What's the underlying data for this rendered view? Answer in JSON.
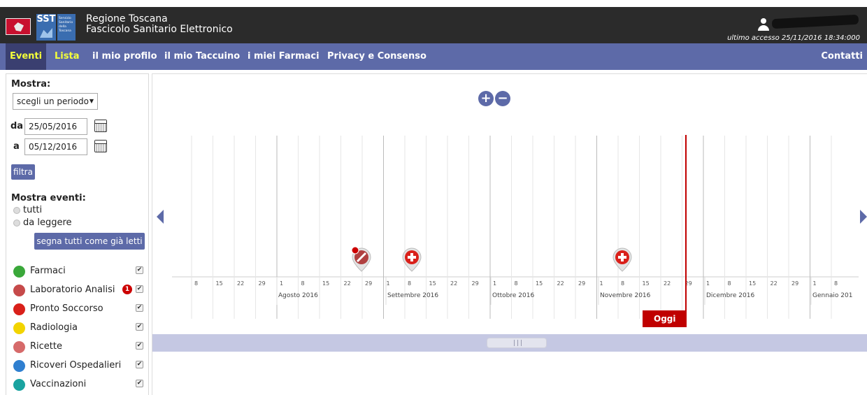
{
  "header": {
    "title_line1": "Regione Toscana",
    "title_line2": "Fascicolo Sanitario Elettronico",
    "sst_logo": "SST",
    "sst_logo_small": "Servizio Sanitario della Toscana",
    "last_access": "ultimo accesso 25/11/2016 18:34:000"
  },
  "nav": {
    "items": [
      "Eventi",
      "Lista",
      "il mio profilo",
      "il mio Taccuino",
      "i miei Farmaci",
      "Privacy e Consenso"
    ],
    "right": "Contatti"
  },
  "sidebar": {
    "show_label": "Mostra:",
    "period_select": "scegli un periodo",
    "from_label": "da",
    "from_value": "25/05/2016",
    "to_label": "a",
    "to_value": "05/12/2016",
    "filter_button": "filtra",
    "show_events_label": "Mostra eventi:",
    "radio_all": "tutti",
    "radio_unread": "da leggere",
    "mark_read_button": "segna tutti come già letti",
    "categories": [
      {
        "label": "Farmaci",
        "color": "#3aa83a",
        "checked": true
      },
      {
        "label": "Laboratorio Analisi",
        "color": "#c64a4a",
        "checked": true,
        "badge": "1"
      },
      {
        "label": "Pronto Soccorso",
        "color": "#d9201a",
        "checked": true
      },
      {
        "label": "Radiologia",
        "color": "#f2d400",
        "checked": true
      },
      {
        "label": "Ricette",
        "color": "#d66a6a",
        "checked": true
      },
      {
        "label": "Ricoveri Ospedalieri",
        "color": "#2f7fd0",
        "checked": true
      },
      {
        "label": "Vaccinazioni",
        "color": "#1aa3a0",
        "checked": true
      }
    ]
  },
  "timeline": {
    "today_label": "Oggi",
    "months": [
      "Agosto 2016",
      "Settembre 2016",
      "Ottobre 2016",
      "Novembre 2016",
      "Dicembre 2016",
      "Gennaio 201"
    ],
    "ticks": [
      "8",
      "15",
      "22",
      "29",
      "1",
      "8",
      "15",
      "22",
      "29",
      "1",
      "8",
      "15",
      "22",
      "29",
      "1",
      "8",
      "15",
      "22",
      "29",
      "1",
      "8",
      "15",
      "22",
      "29",
      "1",
      "8",
      "15",
      "22",
      "29",
      "1",
      "8"
    ],
    "colors": {
      "accent": "#5d6aa8",
      "today": "#c00000",
      "marker": "#d9201a"
    }
  }
}
